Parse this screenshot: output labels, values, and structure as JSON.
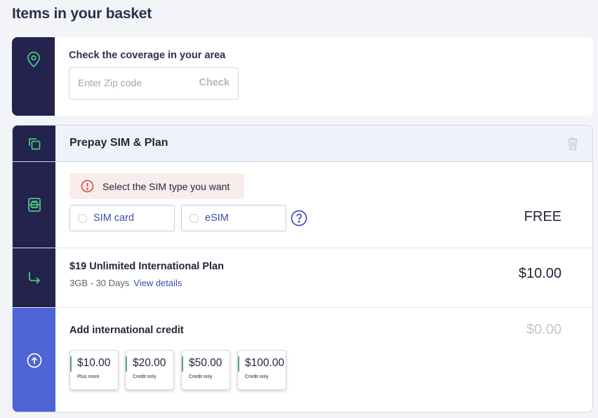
{
  "page": {
    "title": "Items in your basket"
  },
  "coverage": {
    "title": "Check the coverage in your area",
    "zip_placeholder": "Enter Zip code",
    "zip_value": "",
    "check_label": "Check",
    "icon": "map-pin-icon"
  },
  "basket": {
    "header": {
      "title": "Prepay SIM & Plan",
      "icon": "copy-icon",
      "delete_icon": "trash-icon"
    },
    "sim": {
      "icon": "sim-card-icon",
      "alert": "Select the SIM type you want",
      "options": [
        {
          "label": "SIM card",
          "selected": false
        },
        {
          "label": "eSIM",
          "selected": false
        }
      ],
      "help_icon": "help-icon",
      "price": "FREE"
    },
    "plan": {
      "icon": "arrow-down-right-icon",
      "title": "$19 Unlimited International Plan",
      "details": "3GB - 30 Days",
      "link": "View details",
      "price": "$10.00"
    },
    "credit": {
      "icon": "arrow-up-circle-icon",
      "title": "Add international credit",
      "price": "$0.00",
      "options": [
        {
          "amount": "$10.00",
          "note": "Plus more"
        },
        {
          "amount": "$20.00",
          "note": "Credit only"
        },
        {
          "amount": "$50.00",
          "note": "Credit only"
        },
        {
          "amount": "$100.00",
          "note": "Credit only"
        }
      ]
    }
  },
  "colors": {
    "rail": "#23234d",
    "rail_active": "#4d63d6",
    "accent": "#3d4cb5",
    "icon_green": "#4cc483",
    "alert_bg": "#fbecec",
    "alert_icon": "#d9534f"
  }
}
